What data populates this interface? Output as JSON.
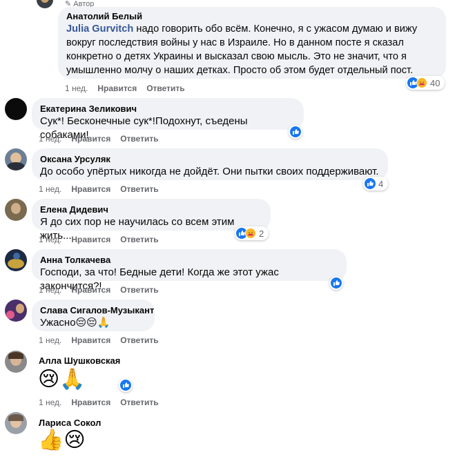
{
  "author_badge": "Автор",
  "comments": [
    {
      "author": "Анатолий Белый",
      "mention": "Julia Gurvitch",
      "text": " надо говорить обо всём. Конечно, я с ужасом думаю и вижу\nвокруг последствия войны у нас в Израиле. Но в данном посте я сказал\nконкретно о детях Украины и высказал свою мысль. Это не значит, что я\nумышленно молчу о наших детках. Просто об этом будет отдельный пост.",
      "time": "1 нед.",
      "like": "Нравится",
      "reply": "Ответить",
      "reaction_count": "40"
    },
    {
      "author": "Екатерина Зеликович",
      "text": "Сук*! Бесконечные сук*!Подохнут, съедены собаками!",
      "time": "1 нед.",
      "like": "Нравится",
      "reply": "Ответить"
    },
    {
      "author": "Оксана Урсуляк",
      "text": "До особо упёртых никогда не дойдёт. Они пытки своих поддерживают.",
      "time": "1 нед.",
      "like": "Нравится",
      "reply": "Ответить",
      "reaction_count": "4"
    },
    {
      "author": "Елена Дидевич",
      "text": "Я до сих пор не научилась со всем этим жить...",
      "time": "1 нед.",
      "like": "Нравится",
      "reply": "Ответить",
      "reaction_count": "2"
    },
    {
      "author": "Анна Толкачева",
      "text": "Господи, за что! Бедные дети! Когда же этот ужас закончится?!",
      "time": "1 нед.",
      "like": "Нравится",
      "reply": "Ответить"
    },
    {
      "author": "Слава Сигалов-Музыкант",
      "text": "Ужасно😔😔🙏",
      "time": "1 нед.",
      "like": "Нравится",
      "reply": "Ответить"
    },
    {
      "author": "Алла Шушковская",
      "text": "😢🙏",
      "time": "1 нед.",
      "like": "Нравится",
      "reply": "Ответить"
    },
    {
      "author": "Лариса Сокол",
      "text": "👍😢"
    }
  ]
}
